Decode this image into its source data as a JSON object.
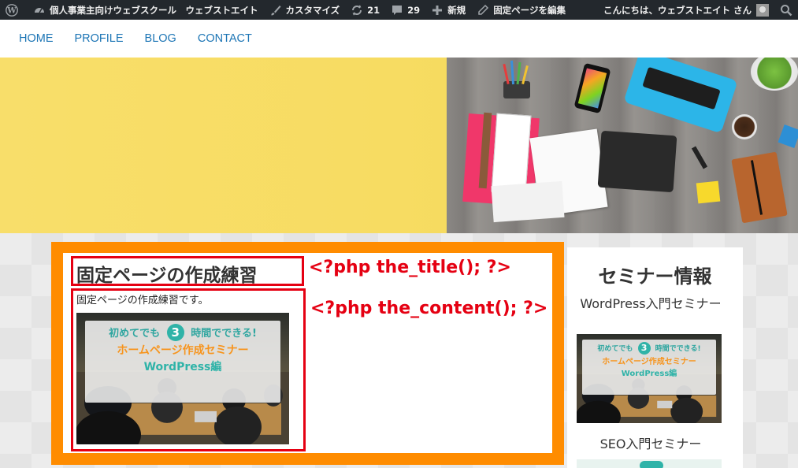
{
  "admin_bar": {
    "site_name": "個人事業主向けウェブスクール　ウェブストエイト",
    "customize": "カスタマイズ",
    "updates_count": "21",
    "comments_count": "29",
    "new_label": "新規",
    "edit_label": "固定ページを編集",
    "greeting": "こんにちは、ウェブストエイト さん"
  },
  "nav": {
    "items": [
      "HOME",
      "PROFILE",
      "BLOG",
      "CONTACT"
    ]
  },
  "page": {
    "title": "固定ページの作成練習",
    "content": "固定ページの作成練習です。"
  },
  "annotations": {
    "title_php": "<?php the_title(); ?>",
    "content_php": "<?php the_content(); ?>"
  },
  "banner": {
    "line1_prefix": "初めてでも",
    "line1_number": "3",
    "line1_suffix": "時間でできる!",
    "line2": "ホームページ作成セミナー",
    "line3": "WordPress編"
  },
  "sidebar": {
    "title": "セミナー情報",
    "items": [
      {
        "title": "WordPress入門セミナー"
      },
      {
        "title": "SEO入門セミナー"
      }
    ]
  },
  "colors": {
    "admin_bar_bg": "#23282d",
    "nav_link": "#1c75b5",
    "frame_orange": "#ff8c00",
    "annotation_red": "#e50012",
    "hero_yellow": "#f8de6a"
  }
}
